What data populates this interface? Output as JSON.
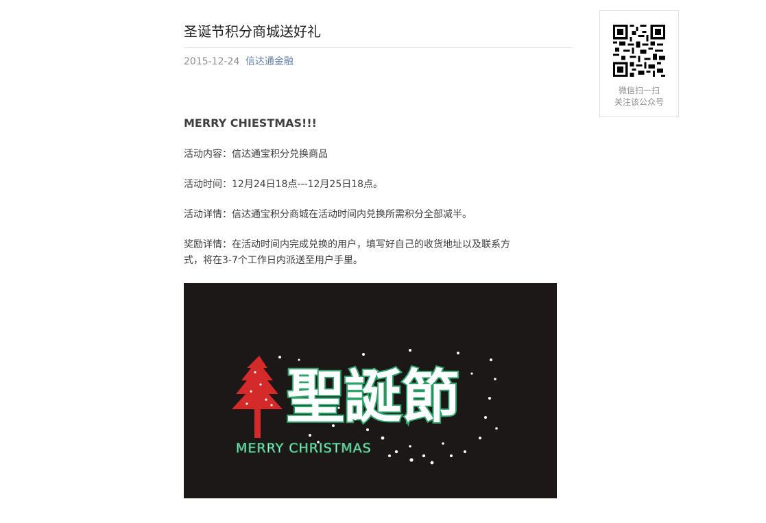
{
  "article": {
    "title": "圣诞节积分商城送好礼",
    "date": "2015-12-24",
    "account_name": "信达通金融",
    "headline": "MERRY CHIESTMAS!!!",
    "paragraphs": [
      "活动内容：信达通宝积分兑换商品",
      "活动时间：12月24日18点---12月25日18点。",
      "活动详情：信达通宝积分商城在活动时间内兑换所需积分全部减半。",
      "奖励详情：在活动时间内完成兑换的用户，填写好自己的收货地址以及联系方式，将在3-7个工作日内派送至用户手里。"
    ],
    "banner": {
      "main_text": "聖誕節",
      "sub_text": "MERRY CHRISTMAS"
    }
  },
  "qr": {
    "caption_line1": "微信扫一扫",
    "caption_line2": "关注该公众号"
  },
  "colors": {
    "accent_link": "#607fa6",
    "banner_bg": "#1b1817",
    "banner_green": "#2fa36b",
    "tree_red": "#d42a2a"
  }
}
